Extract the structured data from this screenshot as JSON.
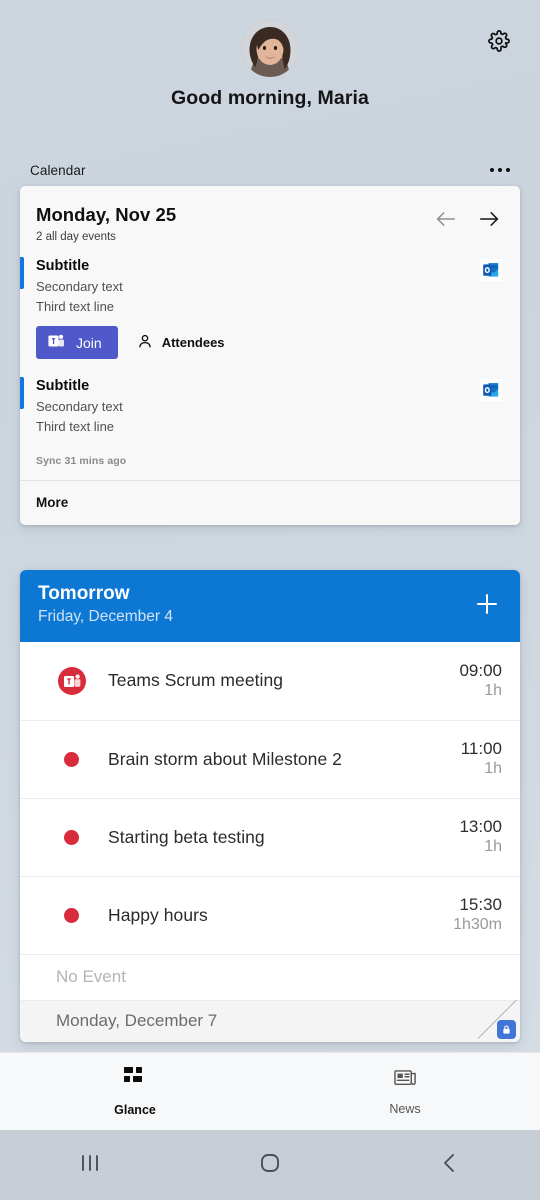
{
  "header": {
    "greeting": "Good morning, Maria",
    "avatar_alt": "user-avatar",
    "settings_icon": "gear-icon"
  },
  "section": {
    "label": "Calendar",
    "overflow_icon": "more-horizontal-icon"
  },
  "calendar_card": {
    "date_title": "Monday, Nov 25",
    "all_day_summary": "2 all day events",
    "prev_icon": "arrow-left-icon",
    "next_icon": "arrow-right-icon",
    "accent_color": "#1277e3",
    "events": [
      {
        "title": "Subtitle",
        "secondary": "Secondary text",
        "third": "Third text line",
        "source_icon": "outlook-icon",
        "join_label": "Join",
        "join_icon": "teams-icon",
        "attendees_label": "Attendees",
        "attendees_icon": "person-icon",
        "has_actions": true
      },
      {
        "title": "Subtitle",
        "secondary": "Secondary text",
        "third": "Third text line",
        "source_icon": "outlook-icon",
        "has_actions": false
      }
    ],
    "sync_status": "Sync 31 mins ago",
    "more_label": "More"
  },
  "tomorrow_card": {
    "header_title": "Tomorrow",
    "header_date": "Friday, December 4",
    "header_color": "#0d78d4",
    "add_icon": "plus-icon",
    "events": [
      {
        "name": "Teams Scrum meeting",
        "time": "09:00",
        "duration": "1h",
        "icon": "teams-circle-icon",
        "dot_color": "#d82c3c"
      },
      {
        "name": "Brain storm about Milestone 2",
        "time": "11:00",
        "duration": "1h",
        "icon": "dot-icon",
        "dot_color": "#d82c3c"
      },
      {
        "name": "Starting beta testing",
        "time": "13:00",
        "duration": "1h",
        "icon": "dot-icon",
        "dot_color": "#d82c3c"
      },
      {
        "name": "Happy hours",
        "time": "15:30",
        "duration": "1h30m",
        "icon": "dot-icon",
        "dot_color": "#d82c3c"
      }
    ],
    "no_event_label": "No Event",
    "next_day_label": "Monday, December 7",
    "resize_badge_icon": "lock-badge-icon"
  },
  "tabbar": {
    "tabs": [
      {
        "label": "Glance",
        "icon": "glance-grid-icon",
        "active": true
      },
      {
        "label": "News",
        "icon": "news-icon",
        "active": false
      }
    ]
  },
  "sysnav": {
    "recents_icon": "recents-icon",
    "home_icon": "home-icon",
    "back_icon": "back-icon"
  }
}
